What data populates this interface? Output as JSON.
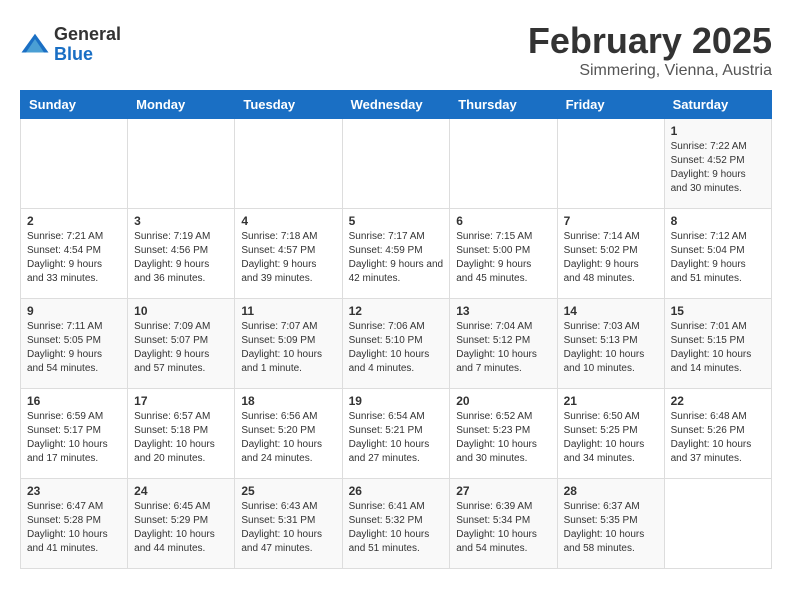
{
  "header": {
    "logo_general": "General",
    "logo_blue": "Blue",
    "month_title": "February 2025",
    "location": "Simmering, Vienna, Austria"
  },
  "weekdays": [
    "Sunday",
    "Monday",
    "Tuesday",
    "Wednesday",
    "Thursday",
    "Friday",
    "Saturday"
  ],
  "weeks": [
    [
      {
        "day": "",
        "sunrise": "",
        "sunset": "",
        "daylight": ""
      },
      {
        "day": "",
        "sunrise": "",
        "sunset": "",
        "daylight": ""
      },
      {
        "day": "",
        "sunrise": "",
        "sunset": "",
        "daylight": ""
      },
      {
        "day": "",
        "sunrise": "",
        "sunset": "",
        "daylight": ""
      },
      {
        "day": "",
        "sunrise": "",
        "sunset": "",
        "daylight": ""
      },
      {
        "day": "",
        "sunrise": "",
        "sunset": "",
        "daylight": ""
      },
      {
        "day": "1",
        "sunrise": "Sunrise: 7:22 AM",
        "sunset": "Sunset: 4:52 PM",
        "daylight": "Daylight: 9 hours and 30 minutes."
      }
    ],
    [
      {
        "day": "2",
        "sunrise": "Sunrise: 7:21 AM",
        "sunset": "Sunset: 4:54 PM",
        "daylight": "Daylight: 9 hours and 33 minutes."
      },
      {
        "day": "3",
        "sunrise": "Sunrise: 7:19 AM",
        "sunset": "Sunset: 4:56 PM",
        "daylight": "Daylight: 9 hours and 36 minutes."
      },
      {
        "day": "4",
        "sunrise": "Sunrise: 7:18 AM",
        "sunset": "Sunset: 4:57 PM",
        "daylight": "Daylight: 9 hours and 39 minutes."
      },
      {
        "day": "5",
        "sunrise": "Sunrise: 7:17 AM",
        "sunset": "Sunset: 4:59 PM",
        "daylight": "Daylight: 9 hours and 42 minutes."
      },
      {
        "day": "6",
        "sunrise": "Sunrise: 7:15 AM",
        "sunset": "Sunset: 5:00 PM",
        "daylight": "Daylight: 9 hours and 45 minutes."
      },
      {
        "day": "7",
        "sunrise": "Sunrise: 7:14 AM",
        "sunset": "Sunset: 5:02 PM",
        "daylight": "Daylight: 9 hours and 48 minutes."
      },
      {
        "day": "8",
        "sunrise": "Sunrise: 7:12 AM",
        "sunset": "Sunset: 5:04 PM",
        "daylight": "Daylight: 9 hours and 51 minutes."
      }
    ],
    [
      {
        "day": "9",
        "sunrise": "Sunrise: 7:11 AM",
        "sunset": "Sunset: 5:05 PM",
        "daylight": "Daylight: 9 hours and 54 minutes."
      },
      {
        "day": "10",
        "sunrise": "Sunrise: 7:09 AM",
        "sunset": "Sunset: 5:07 PM",
        "daylight": "Daylight: 9 hours and 57 minutes."
      },
      {
        "day": "11",
        "sunrise": "Sunrise: 7:07 AM",
        "sunset": "Sunset: 5:09 PM",
        "daylight": "Daylight: 10 hours and 1 minute."
      },
      {
        "day": "12",
        "sunrise": "Sunrise: 7:06 AM",
        "sunset": "Sunset: 5:10 PM",
        "daylight": "Daylight: 10 hours and 4 minutes."
      },
      {
        "day": "13",
        "sunrise": "Sunrise: 7:04 AM",
        "sunset": "Sunset: 5:12 PM",
        "daylight": "Daylight: 10 hours and 7 minutes."
      },
      {
        "day": "14",
        "sunrise": "Sunrise: 7:03 AM",
        "sunset": "Sunset: 5:13 PM",
        "daylight": "Daylight: 10 hours and 10 minutes."
      },
      {
        "day": "15",
        "sunrise": "Sunrise: 7:01 AM",
        "sunset": "Sunset: 5:15 PM",
        "daylight": "Daylight: 10 hours and 14 minutes."
      }
    ],
    [
      {
        "day": "16",
        "sunrise": "Sunrise: 6:59 AM",
        "sunset": "Sunset: 5:17 PM",
        "daylight": "Daylight: 10 hours and 17 minutes."
      },
      {
        "day": "17",
        "sunrise": "Sunrise: 6:57 AM",
        "sunset": "Sunset: 5:18 PM",
        "daylight": "Daylight: 10 hours and 20 minutes."
      },
      {
        "day": "18",
        "sunrise": "Sunrise: 6:56 AM",
        "sunset": "Sunset: 5:20 PM",
        "daylight": "Daylight: 10 hours and 24 minutes."
      },
      {
        "day": "19",
        "sunrise": "Sunrise: 6:54 AM",
        "sunset": "Sunset: 5:21 PM",
        "daylight": "Daylight: 10 hours and 27 minutes."
      },
      {
        "day": "20",
        "sunrise": "Sunrise: 6:52 AM",
        "sunset": "Sunset: 5:23 PM",
        "daylight": "Daylight: 10 hours and 30 minutes."
      },
      {
        "day": "21",
        "sunrise": "Sunrise: 6:50 AM",
        "sunset": "Sunset: 5:25 PM",
        "daylight": "Daylight: 10 hours and 34 minutes."
      },
      {
        "day": "22",
        "sunrise": "Sunrise: 6:48 AM",
        "sunset": "Sunset: 5:26 PM",
        "daylight": "Daylight: 10 hours and 37 minutes."
      }
    ],
    [
      {
        "day": "23",
        "sunrise": "Sunrise: 6:47 AM",
        "sunset": "Sunset: 5:28 PM",
        "daylight": "Daylight: 10 hours and 41 minutes."
      },
      {
        "day": "24",
        "sunrise": "Sunrise: 6:45 AM",
        "sunset": "Sunset: 5:29 PM",
        "daylight": "Daylight: 10 hours and 44 minutes."
      },
      {
        "day": "25",
        "sunrise": "Sunrise: 6:43 AM",
        "sunset": "Sunset: 5:31 PM",
        "daylight": "Daylight: 10 hours and 47 minutes."
      },
      {
        "day": "26",
        "sunrise": "Sunrise: 6:41 AM",
        "sunset": "Sunset: 5:32 PM",
        "daylight": "Daylight: 10 hours and 51 minutes."
      },
      {
        "day": "27",
        "sunrise": "Sunrise: 6:39 AM",
        "sunset": "Sunset: 5:34 PM",
        "daylight": "Daylight: 10 hours and 54 minutes."
      },
      {
        "day": "28",
        "sunrise": "Sunrise: 6:37 AM",
        "sunset": "Sunset: 5:35 PM",
        "daylight": "Daylight: 10 hours and 58 minutes."
      },
      {
        "day": "",
        "sunrise": "",
        "sunset": "",
        "daylight": ""
      }
    ]
  ]
}
